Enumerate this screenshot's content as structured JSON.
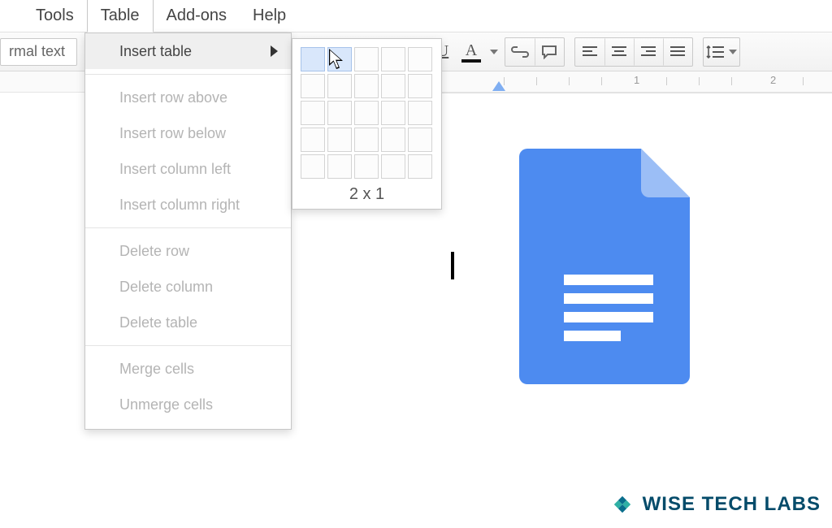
{
  "menubar": {
    "items": [
      "Tools",
      "Table",
      "Add-ons",
      "Help"
    ],
    "active_index": 1
  },
  "toolbar": {
    "style_label": "rmal text",
    "buttons": {
      "underline": "U",
      "text_color": "A"
    }
  },
  "ruler": {
    "marks": [
      "1",
      "2"
    ]
  },
  "table_menu": {
    "items": [
      {
        "label": "Insert table",
        "enabled": true,
        "has_submenu": true
      },
      {
        "label": "Insert row above",
        "enabled": false
      },
      {
        "label": "Insert row below",
        "enabled": false
      },
      {
        "label": "Insert column left",
        "enabled": false
      },
      {
        "label": "Insert column right",
        "enabled": false
      },
      {
        "label": "Delete row",
        "enabled": false
      },
      {
        "label": "Delete column",
        "enabled": false
      },
      {
        "label": "Delete table",
        "enabled": false
      },
      {
        "label": "Merge cells",
        "enabled": false
      },
      {
        "label": "Unmerge cells",
        "enabled": false
      }
    ]
  },
  "table_picker": {
    "cols_selected": 2,
    "rows_selected": 1,
    "label": "2 x 1"
  },
  "watermark": {
    "text": "WISE TECH LABS"
  },
  "colors": {
    "docs_blue": "#4d8bf0",
    "docs_fold": "#9bbef6"
  }
}
